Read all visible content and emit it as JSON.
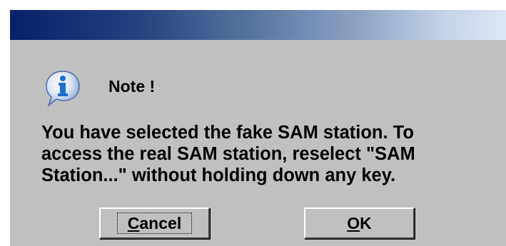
{
  "dialog": {
    "heading": "Note !",
    "message": "You have selected the fake SAM station.  To\naccess the real SAM station, reselect \"SAM\nStation...\" without holding down any key.",
    "icon": "info-icon"
  },
  "buttons": {
    "cancel": {
      "mnemonic": "C",
      "rest": "ancel"
    },
    "ok": {
      "mnemonic": "O",
      "rest": "K"
    }
  },
  "colors": {
    "dialog_bg": "#c0c0c0",
    "titlebar_start": "#0a1f6b",
    "titlebar_end": "#dde7f3",
    "icon_blue": "#1e6fd0"
  }
}
